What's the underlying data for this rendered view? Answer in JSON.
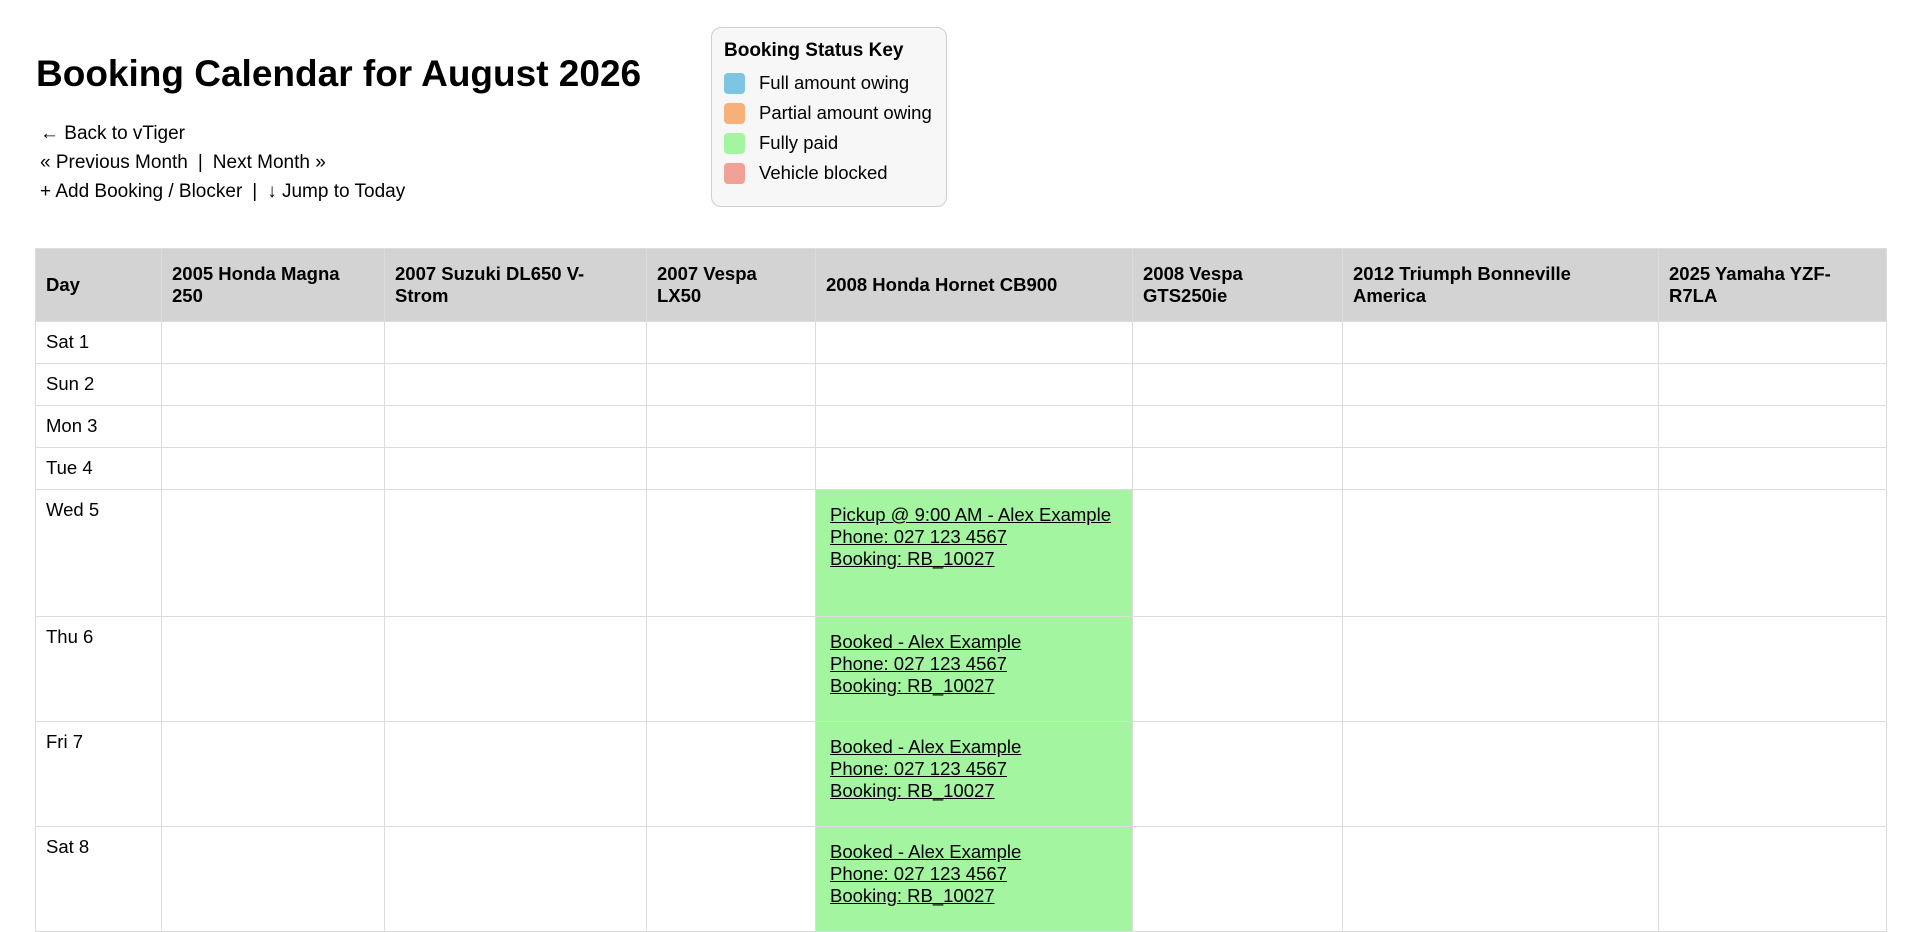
{
  "title": "Booking Calendar for August 2026",
  "nav": {
    "back": "← Back to vTiger",
    "prev": "« Previous Month",
    "sep": "|",
    "next": "Next Month »",
    "add": "+ Add Booking / Blocker",
    "jump": "↓ Jump to Today"
  },
  "legend": {
    "title": "Booking Status Key",
    "items": [
      {
        "label": "Full amount owing",
        "color": "#7ec5e3"
      },
      {
        "label": "Partial amount owing",
        "color": "#f6b07a"
      },
      {
        "label": "Fully paid",
        "color": "#a3f5a0"
      },
      {
        "label": "Vehicle blocked",
        "color": "#f0a298"
      }
    ]
  },
  "table": {
    "headers": [
      "Day",
      "2005 Honda Magna 250",
      "2007 Suzuki DL650 V-Strom",
      "2007 Vespa LX50",
      "2008 Honda Hornet CB900",
      "2008 Vespa GTS250ie",
      "2012 Triumph Bonneville America",
      "2025 Yamaha YZF-R7LA"
    ],
    "rows": [
      {
        "day": "Sat 1"
      },
      {
        "day": "Sun 2"
      },
      {
        "day": "Mon 3"
      },
      {
        "day": "Tue 4"
      },
      {
        "day": "Wed 5",
        "booking": {
          "line1": "Pickup @ 9:00 AM - Alex Example",
          "phone": "Phone: 027 123 4567",
          "ref": "Booking: RB_10027"
        }
      },
      {
        "day": "Thu 6",
        "booking": {
          "line1": "Booked - Alex Example",
          "phone": "Phone: 027 123 4567",
          "ref": "Booking: RB_10027"
        }
      },
      {
        "day": "Fri 7",
        "booking": {
          "line1": "Booked - Alex Example",
          "phone": "Phone: 027 123 4567",
          "ref": "Booking: RB_10027"
        }
      },
      {
        "day": "Sat 8",
        "booking": {
          "line1": "Booked - Alex Example",
          "phone": "Phone: 027 123 4567",
          "ref": "Booking: RB_10027"
        }
      }
    ]
  }
}
